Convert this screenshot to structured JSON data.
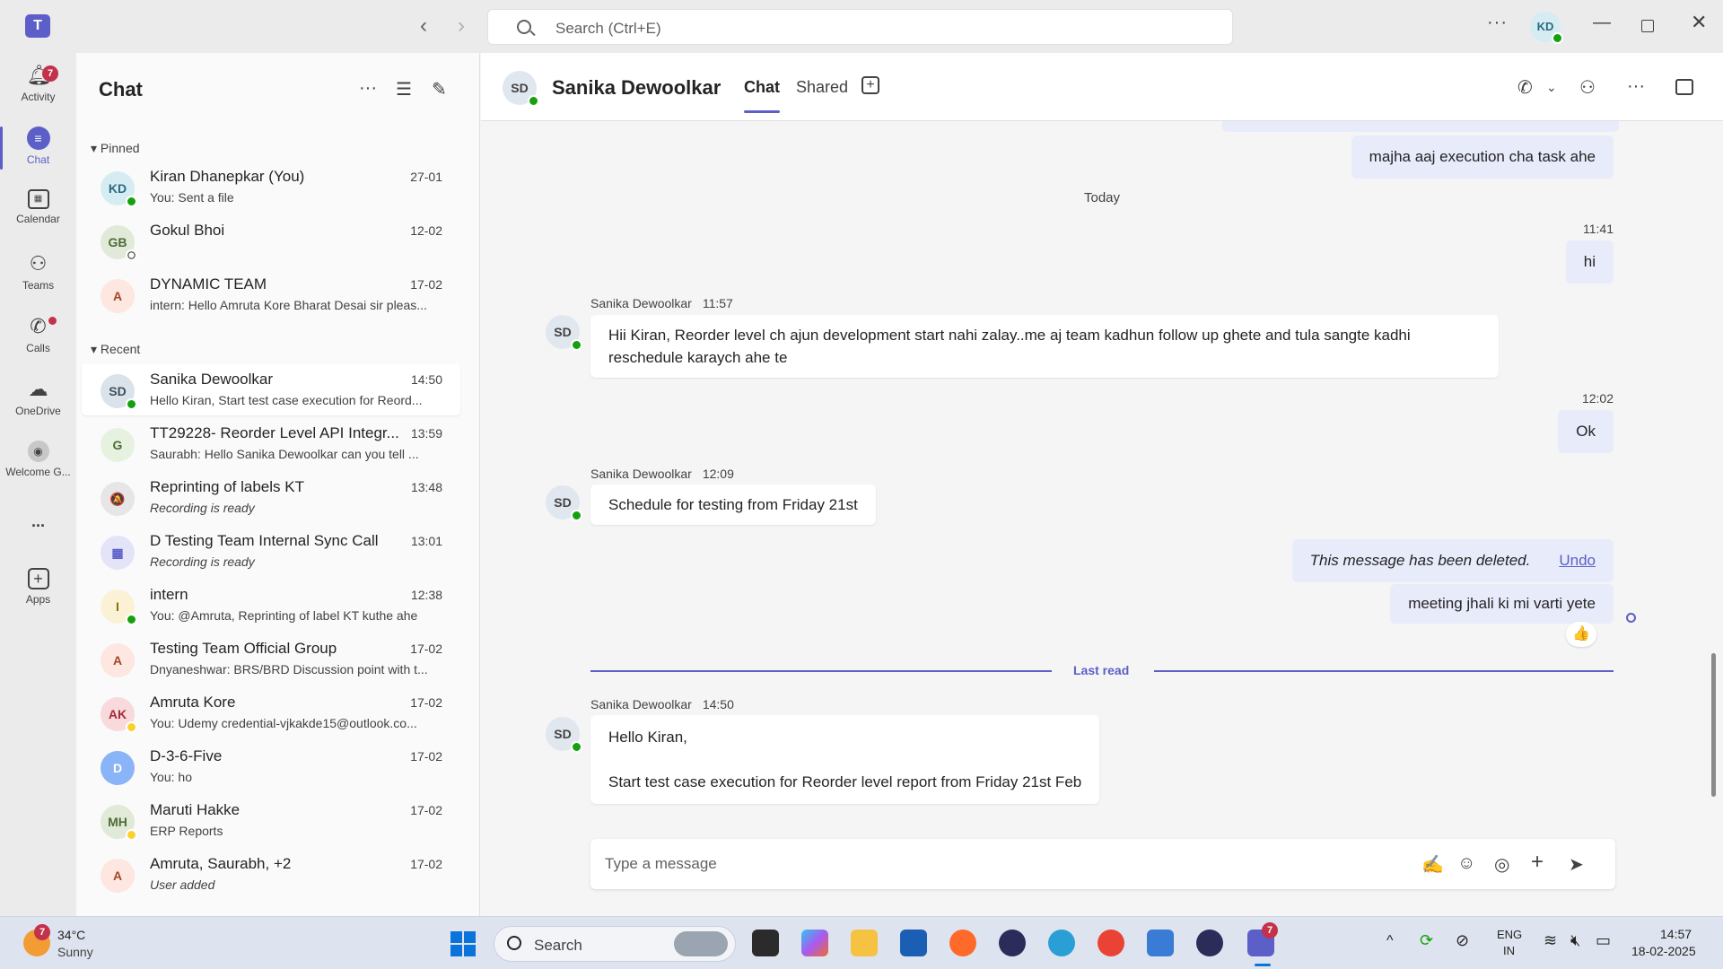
{
  "app": {
    "logo": "T"
  },
  "search": {
    "placeholder": "Search (Ctrl+E)"
  },
  "user": {
    "initials": "KD"
  },
  "rail": [
    {
      "label": "Activity",
      "icon": "bell-icon",
      "badge": "7"
    },
    {
      "label": "Chat",
      "icon": "chat-icon"
    },
    {
      "label": "Calendar",
      "icon": "calendar-icon"
    },
    {
      "label": "Teams",
      "icon": "teams-icon"
    },
    {
      "label": "Calls",
      "icon": "phone-icon"
    },
    {
      "label": "OneDrive",
      "icon": "cloud-icon"
    },
    {
      "label": "Welcome G...",
      "icon": "welcome-icon"
    },
    {
      "label": "...",
      "icon": "more-icon"
    },
    {
      "label": "Apps",
      "icon": "apps-icon"
    }
  ],
  "list": {
    "title": "Chat",
    "pinned_label": "Pinned",
    "recent_label": "Recent",
    "pinned": [
      {
        "initials": "KD",
        "name": "Kiran Dhanepkar (You)",
        "preview": "You: Sent a file",
        "time": "27-01",
        "bg": "#d6ecf3",
        "fg": "#2b6b82",
        "status": "online"
      },
      {
        "initials": "GB",
        "name": "Gokul Bhoi",
        "preview": "",
        "time": "12-02",
        "bg": "#e1ead8",
        "fg": "#4d6b37",
        "status": "offline"
      },
      {
        "initials": "A",
        "name": "DYNAMIC TEAM",
        "preview": "intern: Hello Amruta Kore Bharat Desai sir pleas...",
        "time": "17-02",
        "bg": "#fde7e0",
        "fg": "#a4472a",
        "status": ""
      }
    ],
    "recent": [
      {
        "initials": "SD",
        "name": "Sanika Dewoolkar",
        "preview": "Hello Kiran,   Start test case execution for Reord...",
        "time": "14:50",
        "bg": "#dbe3ea",
        "fg": "#3d4f5e",
        "status": "online"
      },
      {
        "initials": "G",
        "name": "TT29228- Reorder Level API Integr...",
        "preview": "Saurabh: Hello Sanika Dewoolkar can you tell ...",
        "time": "13:59",
        "bg": "#e6f2df",
        "fg": "#4d6b37",
        "status": ""
      },
      {
        "initials": "🔕",
        "name": "Reprinting of labels KT",
        "preview": "Recording is ready",
        "time": "13:48",
        "bg": "#e6e6e6",
        "fg": "#616161",
        "status": "",
        "italic": true
      },
      {
        "initials": "▦",
        "name": "D Testing Team Internal Sync Call",
        "preview": "Recording is ready",
        "time": "13:01",
        "bg": "#e4e4f8",
        "fg": "#5b5fc7",
        "status": "",
        "italic": true
      },
      {
        "initials": "I",
        "name": "intern",
        "preview": "You: @Amruta, Reprinting of label KT kuthe ahe",
        "time": "12:38",
        "bg": "#fbf2d5",
        "fg": "#8a6d0b",
        "status": "online"
      },
      {
        "initials": "A",
        "name": "Testing Team Official Group",
        "preview": "Dnyaneshwar: BRS/BRD Discussion point with t...",
        "time": "17-02",
        "bg": "#fde7e0",
        "fg": "#a4472a",
        "status": ""
      },
      {
        "initials": "AK",
        "name": "Amruta Kore",
        "preview": "You: Udemy credential-vjkakde15@outlook.co...",
        "time": "17-02",
        "bg": "#f8d9dc",
        "fg": "#a52a3a",
        "status": "away"
      },
      {
        "initials": "D",
        "name": "D-3-6-Five",
        "preview": "You: ho",
        "time": "17-02",
        "bg": "#8ab4f8",
        "fg": "#fff",
        "status": ""
      },
      {
        "initials": "MH",
        "name": "Maruti Hakke",
        "preview": "ERP Reports",
        "time": "17-02",
        "bg": "#e1ead8",
        "fg": "#4d6b37",
        "status": "away"
      },
      {
        "initials": "A",
        "name": "Amruta, Saurabh, +2",
        "preview": "User added",
        "time": "17-02",
        "bg": "#fde7e0",
        "fg": "#a4472a",
        "status": "",
        "italic": true
      }
    ]
  },
  "conversation": {
    "initials": "SD",
    "name": "Sanika Dewoolkar",
    "tabs": [
      "Chat",
      "Shared"
    ],
    "day_divider": "Today",
    "last_read": "Last read",
    "messages": [
      {
        "dir": "out",
        "text": "majha aaj execution cha task ahe"
      },
      {
        "dir": "out",
        "time": "11:41",
        "text": "hi"
      },
      {
        "dir": "in",
        "sender": "Sanika Dewoolkar",
        "time": "11:57",
        "lines": [
          "Hii Kiran, Reorder level ch ajun development start nahi zalay..me aj team kadhun follow up ghete and tula sangte kadhi",
          "reschedule karaych ahe te"
        ]
      },
      {
        "dir": "out",
        "time": "12:02",
        "text": "Ok"
      },
      {
        "dir": "in",
        "sender": "Sanika Dewoolkar",
        "time": "12:09",
        "lines": [
          "Schedule for testing from Friday 21st"
        ]
      },
      {
        "dir": "out",
        "deleted": "This message has been deleted.",
        "undo": "Undo"
      },
      {
        "dir": "out",
        "text": "meeting jhali ki mi varti yete",
        "reaction": "👍"
      },
      {
        "dir": "in",
        "sender": "Sanika Dewoolkar",
        "time": "14:50",
        "lines": [
          "Hello Kiran,",
          "",
          "Start test case execution for Reorder level report from Friday 21st Feb"
        ]
      }
    ],
    "compose_placeholder": "Type a message"
  },
  "taskbar": {
    "weather_temp": "34°C",
    "weather_desc": "Sunny",
    "weather_badge": "7",
    "search": "Search",
    "lang1": "ENG",
    "lang2": "IN",
    "time": "14:57",
    "date": "18-02-2025",
    "teams_badge": "7"
  }
}
